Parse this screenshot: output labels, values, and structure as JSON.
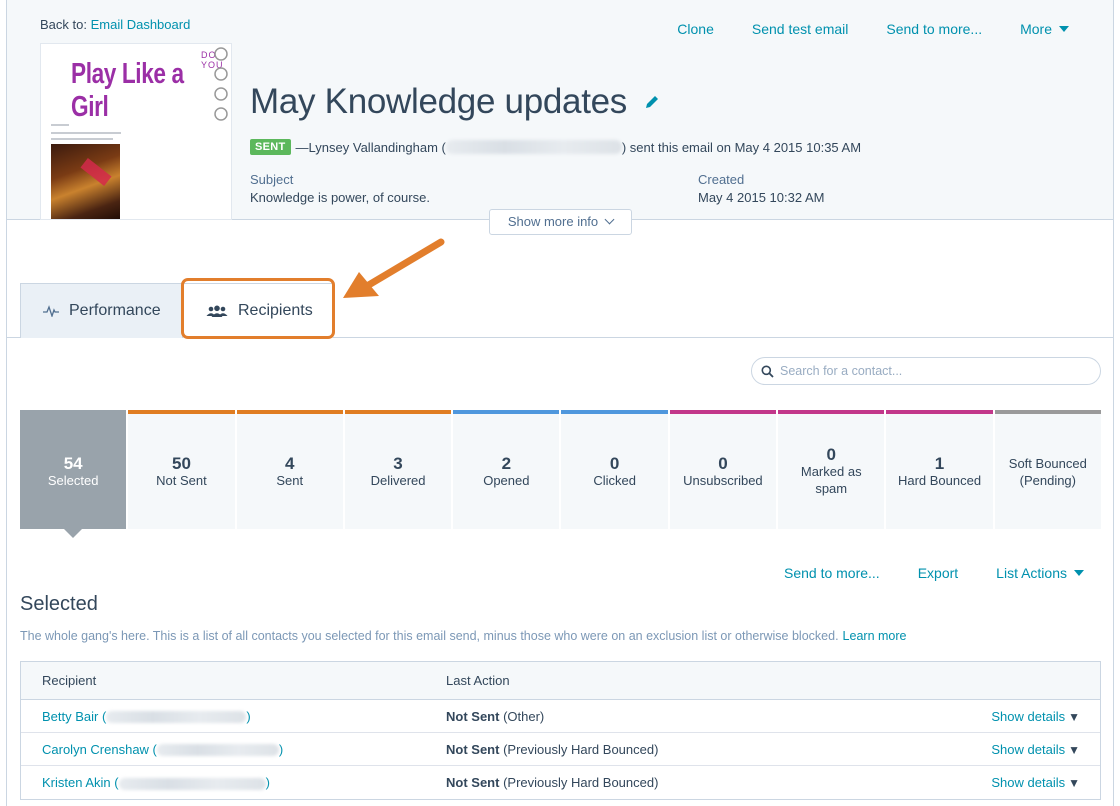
{
  "header": {
    "back_prefix": "Back to:",
    "back_link": "Email Dashboard",
    "actions": [
      "Clone",
      "Send test email",
      "Send to more...",
      "More"
    ],
    "thumbnail": {
      "brand": "Play Like a Girl",
      "tagline": "DO YOU"
    },
    "title": "May Knowledge updates",
    "status_badge": "SENT",
    "sender_prefix": "—Lynsey Vallandingham (",
    "sender_suffix": ") sent this email on May 4 2015 10:35 AM",
    "subject_label": "Subject",
    "subject_value": "Knowledge is power, of course.",
    "created_label": "Created",
    "created_value": "May 4 2015 10:32 AM",
    "show_more": "Show more info"
  },
  "tabs": [
    {
      "label": "Performance",
      "icon": "pulse-icon"
    },
    {
      "label": "Recipients",
      "icon": "people-icon"
    }
  ],
  "search": {
    "placeholder": "Search for a contact..."
  },
  "stats": [
    {
      "num": "54",
      "label": "Selected",
      "color": "#99a3ab",
      "active": true
    },
    {
      "num": "50",
      "label": "Not Sent",
      "color": "#e07d22"
    },
    {
      "num": "4",
      "label": "Sent",
      "color": "#e07d22"
    },
    {
      "num": "3",
      "label": "Delivered",
      "color": "#e07d22"
    },
    {
      "num": "2",
      "label": "Opened",
      "color": "#4f97dd"
    },
    {
      "num": "0",
      "label": "Clicked",
      "color": "#4f97dd"
    },
    {
      "num": "0",
      "label": "Unsubscribed",
      "color": "#c2378a"
    },
    {
      "num": "0",
      "label": "Marked as\nspam",
      "color": "#c2378a"
    },
    {
      "num": "1",
      "label": "Hard Bounced",
      "color": "#c2378a"
    },
    {
      "num": "",
      "label": "Soft Bounced\n(Pending)",
      "color": "#9a9a9a"
    }
  ],
  "list_actions": [
    "Send to more...",
    "Export",
    "List Actions"
  ],
  "section": {
    "title": "Selected",
    "description": "The whole gang's here. This is a list of all contacts you selected for this email send, minus those who were on an exclusion list or otherwise blocked.",
    "learn_more": "Learn more"
  },
  "table": {
    "headers": [
      "Recipient",
      "Last Action"
    ],
    "rows": [
      {
        "name": "Betty Bair",
        "status": "Not Sent",
        "reason": "(Other)",
        "action": "Show details"
      },
      {
        "name": "Carolyn Crenshaw",
        "status": "Not Sent",
        "reason": "(Previously Hard Bounced)",
        "action": "Show details"
      },
      {
        "name": "Kristen Akin",
        "status": "Not Sent",
        "reason": "(Previously Hard Bounced)",
        "action": "Show details"
      }
    ]
  }
}
